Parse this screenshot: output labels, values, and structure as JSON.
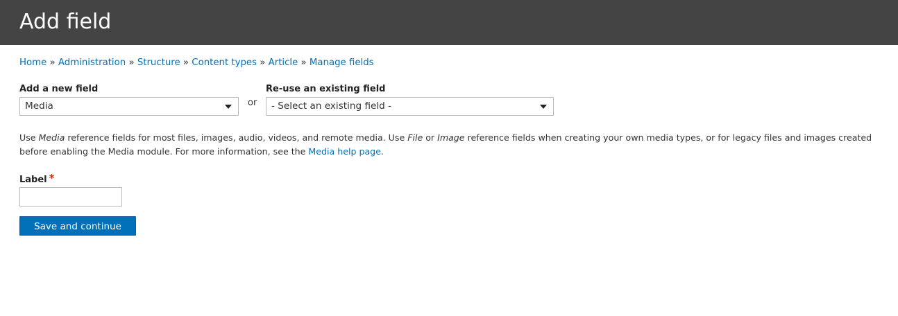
{
  "page": {
    "title": "Add field"
  },
  "breadcrumb": {
    "separator": "»",
    "items": [
      {
        "label": "Home"
      },
      {
        "label": "Administration"
      },
      {
        "label": "Structure"
      },
      {
        "label": "Content types"
      },
      {
        "label": "Article"
      },
      {
        "label": "Manage fields"
      }
    ]
  },
  "add_new_field": {
    "label": "Add a new field",
    "selected_value": "Media"
  },
  "or_text": "or",
  "reuse_field": {
    "label": "Re-use an existing field",
    "selected_value": "- Select an existing field -"
  },
  "description": {
    "part1": "Use ",
    "media_em": "Media",
    "part2": " reference fields for most files, images, audio, videos, and remote media. Use ",
    "file_em": "File",
    "part3": " or ",
    "image_em": "Image",
    "part4": " reference fields when creating your own media types, or for legacy files and images created before enabling the Media module. For more information, see the ",
    "help_link": "Media help page",
    "part5": "."
  },
  "label_field": {
    "label": "Label",
    "required_marker": "*",
    "value": ""
  },
  "save_button": {
    "label": "Save and continue"
  },
  "colors": {
    "header_bg": "#444444",
    "link": "#0071b8",
    "primary_button": "#0071b8",
    "required": "#e32700"
  },
  "icons": {
    "select_caret": "chevron-down-icon"
  }
}
